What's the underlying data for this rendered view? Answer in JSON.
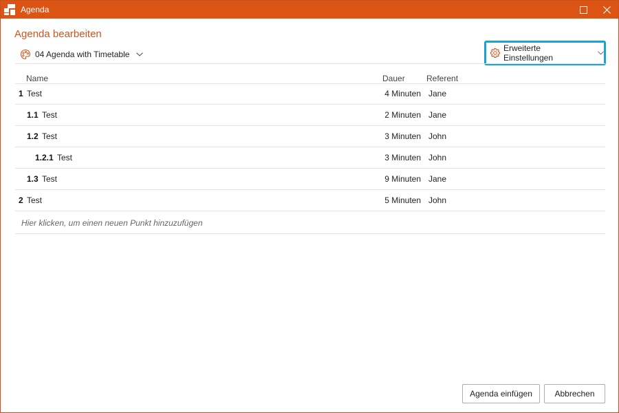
{
  "window": {
    "title": "Agenda",
    "accent_color": "#dc5413",
    "focus_color": "#1aa3cc"
  },
  "dialog": {
    "heading": "Agenda bearbeiten",
    "template": {
      "label": "04 Agenda with Timetable",
      "icon": "palette-icon"
    },
    "advanced_settings": {
      "label": "Erweiterte Einstellungen",
      "icon": "gear-icon"
    }
  },
  "table": {
    "columns": {
      "name": "Name",
      "duration": "Dauer",
      "presenter": "Referent"
    },
    "rows": [
      {
        "number": "1",
        "name": "Test",
        "duration": "4 Minuten",
        "presenter": "Jane",
        "level": 0
      },
      {
        "number": "1.1",
        "name": "Test",
        "duration": "2 Minuten",
        "presenter": "Jane",
        "level": 1
      },
      {
        "number": "1.2",
        "name": "Test",
        "duration": "3 Minuten",
        "presenter": "John",
        "level": 1
      },
      {
        "number": "1.2.1",
        "name": "Test",
        "duration": "3 Minuten",
        "presenter": "John",
        "level": 2
      },
      {
        "number": "1.3",
        "name": "Test",
        "duration": "9 Minuten",
        "presenter": "Jane",
        "level": 1
      },
      {
        "number": "2",
        "name": "Test",
        "duration": "5 Minuten",
        "presenter": "John",
        "level": 0
      }
    ],
    "add_hint": "Hier klicken, um einen neuen Punkt hinzuzufügen"
  },
  "footer": {
    "insert_label": "Agenda einfügen",
    "cancel_label": "Abbrechen"
  }
}
